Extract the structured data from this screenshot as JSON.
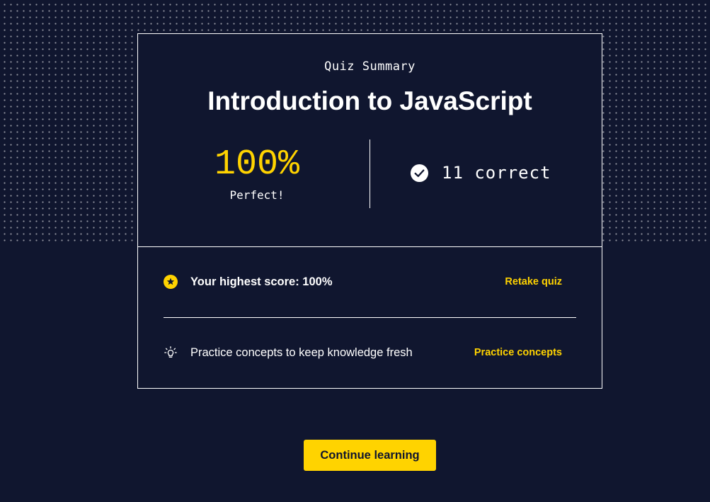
{
  "summary": {
    "eyebrow": "Quiz Summary",
    "title": "Introduction to JavaScript",
    "score_percent": "100%",
    "score_label": "Perfect!",
    "correct_text": "11 correct"
  },
  "details": {
    "highest_score_text": "Your highest score: 100%",
    "retake_label": "Retake quiz",
    "practice_text": "Practice concepts to keep knowledge fresh",
    "practice_label": "Practice concepts"
  },
  "footer": {
    "continue_label": "Continue learning"
  },
  "icons": {
    "check": "check-circle-icon",
    "star": "star-badge-icon",
    "lightbulb": "lightbulb-icon"
  },
  "colors": {
    "background": "#10162f",
    "accent": "#ffd300",
    "text": "#ffffff"
  }
}
